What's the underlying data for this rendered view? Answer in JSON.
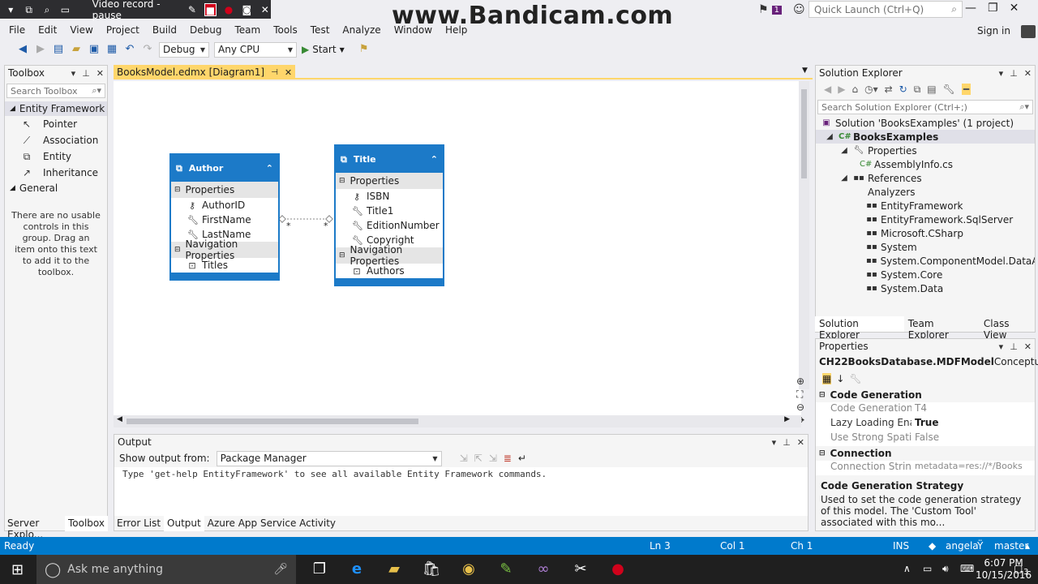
{
  "recorder": {
    "label": "Video record - pause"
  },
  "watermark": "www.Bandicam.com",
  "quick_launch": "Quick Launch (Ctrl+Q)",
  "notif_count": "1",
  "menu": [
    "File",
    "Edit",
    "View",
    "Project",
    "Build",
    "Debug",
    "Team",
    "Tools",
    "Test",
    "Analyze",
    "Window",
    "Help"
  ],
  "signin": "Sign in",
  "toolbar": {
    "config": "Debug",
    "platform": "Any CPU",
    "start": "Start"
  },
  "toolbox": {
    "title": "Toolbox",
    "search_placeholder": "Search Toolbox",
    "group1": "Entity Framework",
    "items": [
      "Pointer",
      "Association",
      "Entity",
      "Inheritance"
    ],
    "group2": "General",
    "empty_text": "There are no usable controls in this group. Drag an item onto this text to add it to the toolbox.",
    "tabs": [
      "Server Explo...",
      "Toolbox"
    ]
  },
  "doc_tab": "BooksModel.edmx [Diagram1]",
  "entities": {
    "author": {
      "name": "Author",
      "properties_label": "Properties",
      "props": [
        "AuthorID",
        "FirstName",
        "LastName"
      ],
      "nav_label": "Navigation Properties",
      "nav": [
        "Titles"
      ]
    },
    "title": {
      "name": "Title",
      "properties_label": "Properties",
      "props": [
        "ISBN",
        "Title1",
        "EditionNumber",
        "Copyright"
      ],
      "nav_label": "Navigation Properties",
      "nav": [
        "Authors"
      ]
    },
    "assoc_left": "*",
    "assoc_right": "*"
  },
  "output": {
    "title": "Output",
    "show_from_label": "Show output from:",
    "source": "Package Manager",
    "text": "Type 'get-help EntityFramework' to see all available Entity Framework commands.",
    "tabs": [
      "Error List",
      "Output",
      "Azure App Service Activity"
    ]
  },
  "solution": {
    "title": "Solution Explorer",
    "search_placeholder": "Search Solution Explorer (Ctrl+;)",
    "tree": [
      {
        "text": "Solution 'BooksExamples' (1 project)"
      },
      {
        "text": "BooksExamples"
      },
      {
        "text": "Properties"
      },
      {
        "text": "AssemblyInfo.cs"
      },
      {
        "text": "References"
      },
      {
        "text": "Analyzers"
      },
      {
        "text": "EntityFramework"
      },
      {
        "text": "EntityFramework.SqlServer"
      },
      {
        "text": "Microsoft.CSharp"
      },
      {
        "text": "System"
      },
      {
        "text": "System.ComponentModel.DataAnn"
      },
      {
        "text": "System.Core"
      },
      {
        "text": "System.Data"
      }
    ],
    "tabs": [
      "Solution Explorer",
      "Team Explorer",
      "Class View"
    ]
  },
  "properties": {
    "title": "Properties",
    "object": "CH22BooksDatabase.MDFModel",
    "object_type": "ConceptualEntit",
    "cat1": "Code Generation",
    "rows1": [
      {
        "name": "Code Generation Strate",
        "value": "T4"
      },
      {
        "name": "Lazy Loading Enabled",
        "value": "True"
      },
      {
        "name": "Use Strong Spatial Type",
        "value": "False"
      }
    ],
    "cat2": "Connection",
    "rows2": [
      {
        "name": "Connection String",
        "value": "metadata=res://*/Books"
      }
    ],
    "desc_title": "Code Generation Strategy",
    "desc_text": "Used to set the code generation strategy of this model. The 'Custom Tool' associated with this mo..."
  },
  "status": {
    "state": "Ready",
    "ln": "Ln 3",
    "col": "Col 1",
    "ch": "Ch 1",
    "ins": "INS",
    "user": "angela",
    "branch": "master"
  },
  "taskbar": {
    "search": "Ask me anything",
    "time": "6:07 PM",
    "date": "10/15/2016",
    "notif": "3"
  }
}
